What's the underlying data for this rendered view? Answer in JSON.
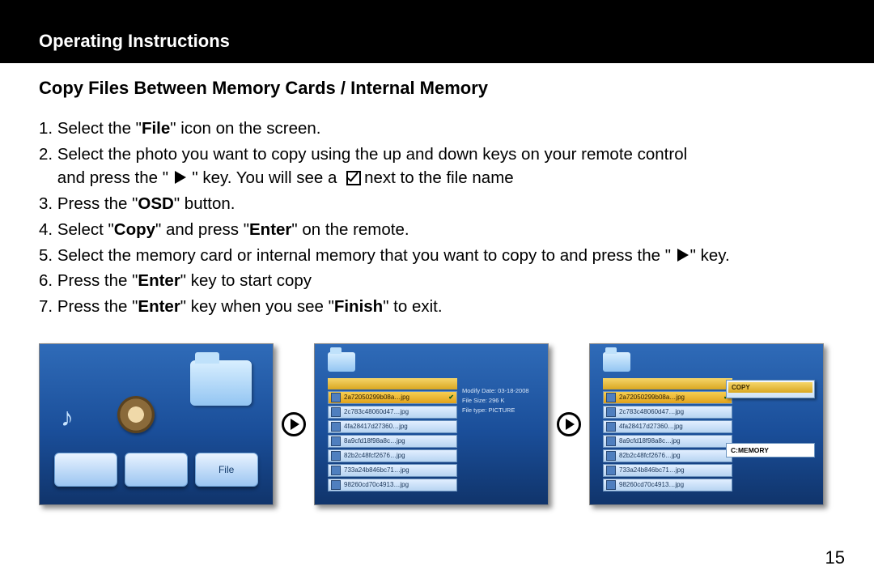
{
  "header": {
    "title": "Operating Instructions"
  },
  "section": {
    "title": "Copy Files Between Memory Cards / Internal Memory"
  },
  "steps": {
    "n1": "1.",
    "s1a": "Select the \"",
    "s1b": "File",
    "s1c": "\" icon on the screen.",
    "n2": "2.",
    "s2a": "Select the photo you want to copy using the up and down keys on your remote control",
    "s2b": "and press the \" ",
    "s2c": " \" key.  You will see a ",
    "s2d": "next to the file name",
    "n3": "3.",
    "s3a": "Press the \"",
    "s3b": "OSD",
    "s3c": "\" button.",
    "n4": "4.",
    "s4a": "Select \"",
    "s4b": "Copy",
    "s4c": "\" and press \"",
    "s4d": "Enter",
    "s4e": "\" on the remote.",
    "n5": "5.",
    "s5a": "Select the memory card or internal memory that you want to copy to and press the \" ",
    "s5b": "\" key.",
    "n6": "6.",
    "s6a": "Press the \"",
    "s6b": "Enter",
    "s6c": "\" key to start copy",
    "n7": "7.",
    "s7a": "Press the \"",
    "s7b": "Enter",
    "s7c": "\" key when you see \"",
    "s7d": "Finish",
    "s7e": "\" to exit."
  },
  "shot1": {
    "dock_label": "File"
  },
  "filelist": {
    "header_cell": "",
    "rows": [
      "2a72050299b08a…jpg",
      "2c783c48060d47…jpg",
      "4fa28417d27360…jpg",
      "8a9cfd18f98a8c…jpg",
      "82b2c48fcf2676…jpg",
      "733a24b846bc71…jpg",
      "98260cd70c4913…jpg"
    ]
  },
  "meta": {
    "l1": "Modify Date: 03-18-2008",
    "l2": "File Size: 296 K",
    "l3": "File type: PICTURE"
  },
  "popup": {
    "title": "COPY",
    "row1": ""
  },
  "dest": {
    "label": "C:MEMORY"
  },
  "page_number": "15"
}
